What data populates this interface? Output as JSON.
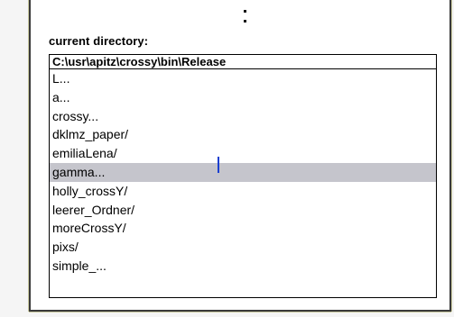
{
  "dialog": {
    "current_directory_label": "current directory:",
    "path_value": "C:\\usr\\apitz\\crossy\\bin\\Release"
  },
  "file_list": {
    "items": [
      {
        "label": "L..."
      },
      {
        "label": "a..."
      },
      {
        "label": "crossy..."
      },
      {
        "label": "dklmz_paper/"
      },
      {
        "label": "emiliaLena/"
      },
      {
        "label": "gamma...",
        "selected": true
      },
      {
        "label": "holly_crossY/"
      },
      {
        "label": "leerer_Ordner/"
      },
      {
        "label": "moreCrossY/"
      },
      {
        "label": "pixs/"
      },
      {
        "label": "simple_..."
      }
    ],
    "selected_index": 5
  },
  "colors": {
    "selection": "#c5c5cc",
    "caret": "#1a3fd0",
    "frame_border": "#3a3a3a"
  }
}
